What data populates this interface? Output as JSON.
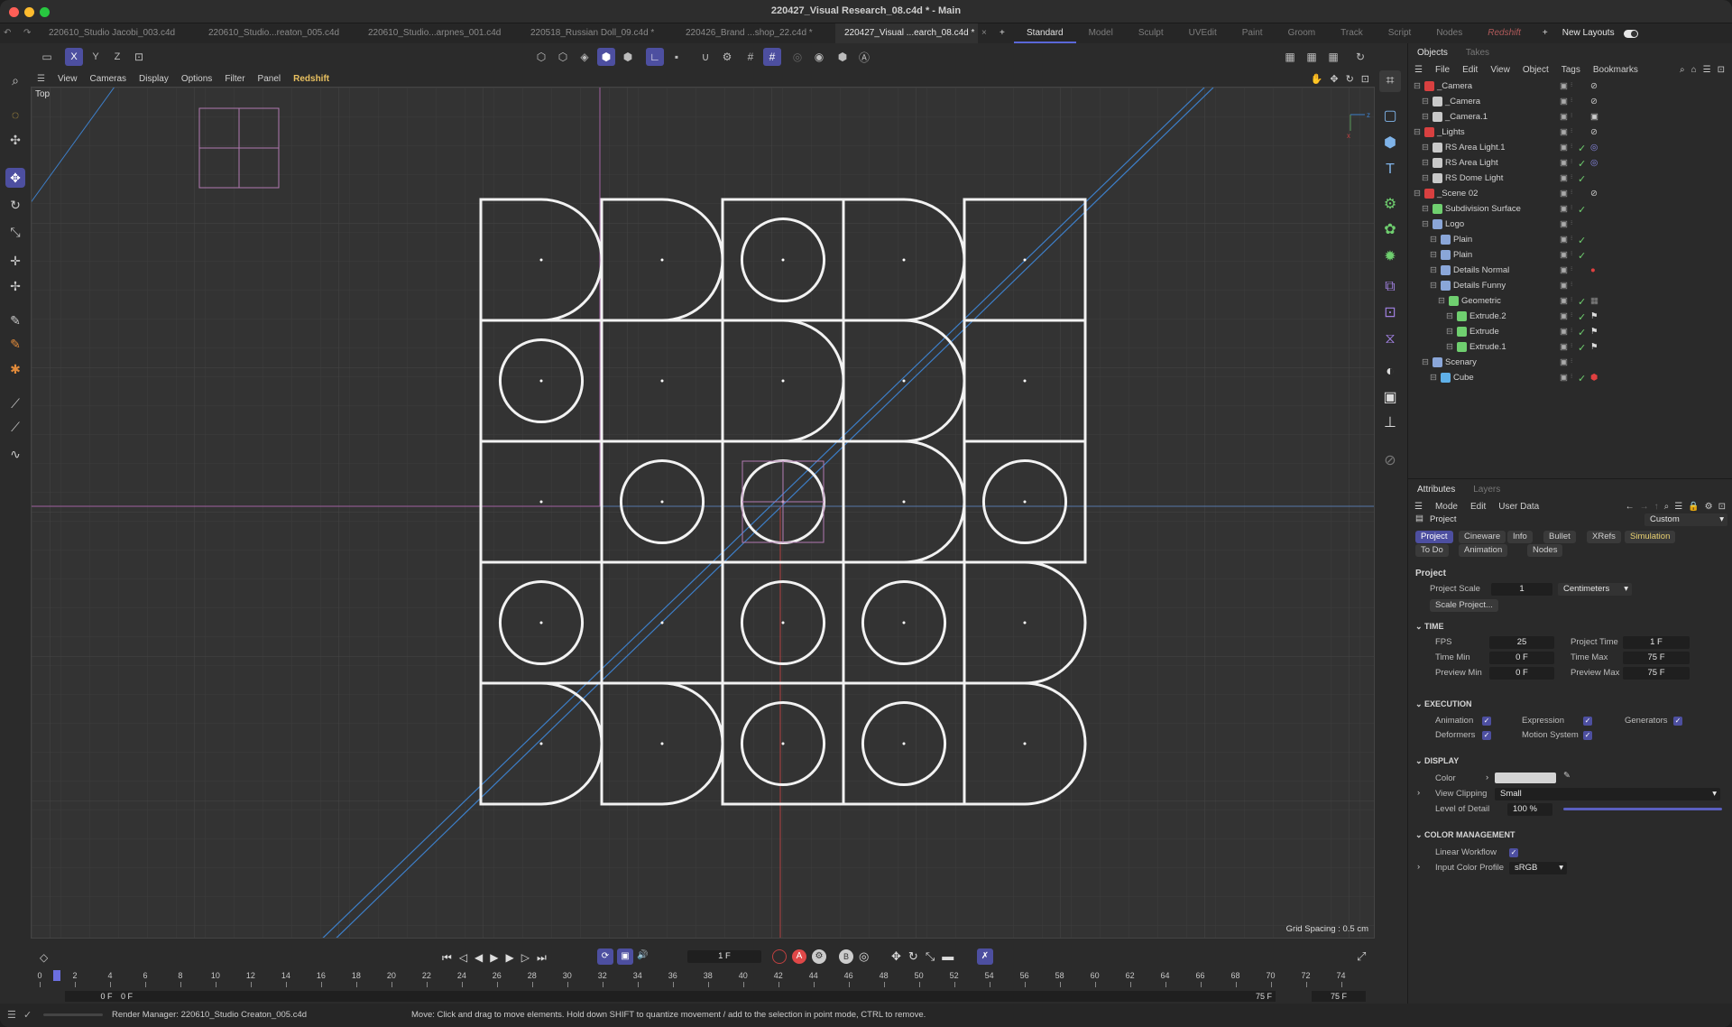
{
  "window": {
    "title": "220427_Visual Research_08.c4d * - Main"
  },
  "doc_tabs": [
    "220610_Studio Jacobi_003.c4d",
    "220610_Studio...reaton_005.c4d",
    "220610_Studio...arpnes_001.c4d",
    "220518_Russian Doll_09.c4d *",
    "220426_Brand ...shop_22.c4d *",
    "220427_Visual ...earch_08.c4d *"
  ],
  "layouts": [
    "Standard",
    "Model",
    "Sculpt",
    "UVEdit",
    "Paint",
    "Groom",
    "Track",
    "Script",
    "Nodes",
    "Redshift"
  ],
  "new_layouts": "New Layouts",
  "toolbar": {
    "x": "X",
    "y": "Y",
    "z": "Z"
  },
  "viewport_menu": [
    "View",
    "Cameras",
    "Display",
    "Options",
    "Filter",
    "Panel",
    "Redshift"
  ],
  "viewport": {
    "name": "Top",
    "grid_spacing": "Grid Spacing : 0.5 cm"
  },
  "grid_pattern": [
    [
      "D",
      "D",
      "O",
      "D",
      "S"
    ],
    [
      "O",
      "S",
      "D",
      "D",
      "S"
    ],
    [
      "S",
      "O",
      "O",
      "D",
      "O"
    ],
    [
      "O",
      "S",
      "O",
      "O",
      "D"
    ],
    [
      "D",
      "D",
      "O",
      "O",
      "D"
    ]
  ],
  "panel": {
    "tabs": [
      "Objects",
      "Takes"
    ],
    "menu": [
      "File",
      "Edit",
      "View",
      "Object",
      "Tags",
      "Bookmarks"
    ],
    "objects": [
      {
        "name": "_Camera",
        "indent": 0,
        "icon": "null",
        "tag": "no"
      },
      {
        "name": "_Camera",
        "indent": 1,
        "icon": "cam",
        "tag": "no"
      },
      {
        "name": "_Camera.1",
        "indent": 1,
        "icon": "cam",
        "tag": "target"
      },
      {
        "name": "_Lights",
        "indent": 0,
        "icon": "null",
        "tag": "no"
      },
      {
        "name": "RS Area Light.1",
        "indent": 1,
        "icon": "light",
        "check": "✓",
        "tag": "rs"
      },
      {
        "name": "RS Area Light",
        "indent": 1,
        "icon": "light",
        "check": "✓",
        "tag": "rs"
      },
      {
        "name": "RS Dome Light",
        "indent": 1,
        "icon": "light",
        "check": "✓"
      },
      {
        "name": "_Scene 02",
        "indent": 0,
        "icon": "null",
        "tag": "no"
      },
      {
        "name": "Subdivision Surface",
        "indent": 1,
        "icon": "subd",
        "check": "✓"
      },
      {
        "name": "Logo",
        "indent": 1,
        "icon": "null"
      },
      {
        "name": "Plain",
        "indent": 2,
        "icon": "null",
        "check": "✓"
      },
      {
        "name": "Plain",
        "indent": 2,
        "icon": "null",
        "check": "✓"
      },
      {
        "name": "Details Normal",
        "indent": 2,
        "icon": "null",
        "tag": "dot"
      },
      {
        "name": "Details Funny",
        "indent": 2,
        "icon": "null"
      },
      {
        "name": "Geometric",
        "indent": 3,
        "icon": "geo",
        "check": "✓",
        "tag": "tex"
      },
      {
        "name": "Extrude.2",
        "indent": 4,
        "icon": "ext",
        "check": "✓",
        "tag": "flag"
      },
      {
        "name": "Extrude",
        "indent": 4,
        "icon": "ext",
        "check": "✓",
        "tag": "flag"
      },
      {
        "name": "Extrude.1",
        "indent": 4,
        "icon": "ext",
        "check": "✓",
        "tag": "flag"
      },
      {
        "name": "Scenary",
        "indent": 1,
        "icon": "null"
      },
      {
        "name": "Cube",
        "indent": 2,
        "icon": "cube",
        "check": "✓",
        "tag": "mat"
      }
    ],
    "attr_tabs": [
      "Attributes",
      "Layers"
    ],
    "attr_menu": [
      "Mode",
      "Edit",
      "User Data"
    ],
    "attr_object": "Project",
    "attr_preset": "Custom",
    "attr_pills": [
      "Project",
      "Cineware",
      "Info",
      "Bullet",
      "XRefs",
      "Simulation",
      "To Do",
      "Animation",
      "Nodes"
    ],
    "section_project": "Project",
    "project_scale_label": "Project Scale",
    "project_scale": "1",
    "scale_unit": "Centimeters",
    "scale_btn": "Scale Project...",
    "time": {
      "title": "TIME",
      "fps_l": "FPS",
      "fps": "25",
      "pt_l": "Project Time",
      "pt": "1 F",
      "tmin_l": "Time Min",
      "tmin": "0 F",
      "tmax_l": "Time Max",
      "tmax": "75 F",
      "pmin_l": "Preview Min",
      "pmin": "0 F",
      "pmax_l": "Preview Max",
      "pmax": "75 F"
    },
    "execution": {
      "title": "EXECUTION",
      "items": [
        "Animation",
        "Expression",
        "Generators",
        "Deformers",
        "Motion System"
      ]
    },
    "display": {
      "title": "DISPLAY",
      "color_l": "Color",
      "clip_l": "View Clipping",
      "clip": "Small",
      "lod_l": "Level of Detail",
      "lod": "100 %",
      "lod_level": 1.0
    },
    "color_mgmt": {
      "title": "COLOR MANAGEMENT",
      "lw_l": "Linear Workflow",
      "icp_l": "Input Color Profile",
      "icp": "sRGB"
    }
  },
  "timeline": {
    "frame": "1 F",
    "ticks": [
      "0",
      "2",
      "4",
      "6",
      "8",
      "10",
      "12",
      "14",
      "16",
      "18",
      "20",
      "22",
      "24",
      "26",
      "28",
      "30",
      "32",
      "34",
      "36",
      "38",
      "40",
      "42",
      "44",
      "46",
      "48",
      "50",
      "52",
      "54",
      "56",
      "58",
      "60",
      "62",
      "64",
      "66",
      "68",
      "70",
      "72",
      "74"
    ],
    "start": "0 F",
    "start2": "0 F",
    "end": "75 F",
    "end2": "75 F"
  },
  "status": {
    "render": "Render Manager: 220610_Studio Creaton_005.c4d",
    "hint": "Move: Click and drag to move elements. Hold down SHIFT to quantize movement / add to the selection in point mode, CTRL to remove."
  }
}
